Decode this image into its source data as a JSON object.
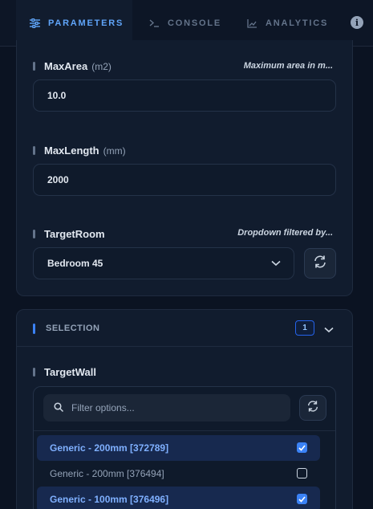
{
  "tabs": [
    {
      "label": "PARAMETERS",
      "icon": "sliders-icon",
      "active": true
    },
    {
      "label": "CONSOLE",
      "icon": "terminal-icon",
      "active": false
    },
    {
      "label": "ANALYTICS",
      "icon": "chart-icon",
      "active": false
    }
  ],
  "info_glyph": "i",
  "params": {
    "max_area": {
      "label": "MaxArea",
      "unit": "(m2)",
      "description": "Maximum area in m...",
      "value": "10.0"
    },
    "max_length": {
      "label": "MaxLength",
      "unit": "(mm)",
      "value": "2000"
    },
    "target_room": {
      "label": "TargetRoom",
      "description": "Dropdown filtered by...",
      "value": "Bedroom 45"
    }
  },
  "selection": {
    "title": "SELECTION",
    "count": "1",
    "field_label": "TargetWall",
    "filter_placeholder": "Filter options...",
    "options": [
      {
        "label": "Generic - 200mm [372789]",
        "checked": true
      },
      {
        "label": "Generic - 200mm [376494]",
        "checked": false
      },
      {
        "label": "Generic - 100mm [376496]",
        "checked": true
      }
    ]
  },
  "colors": {
    "accent": "#3b82f6",
    "background": "#0b1322",
    "card": "#111c2e"
  }
}
